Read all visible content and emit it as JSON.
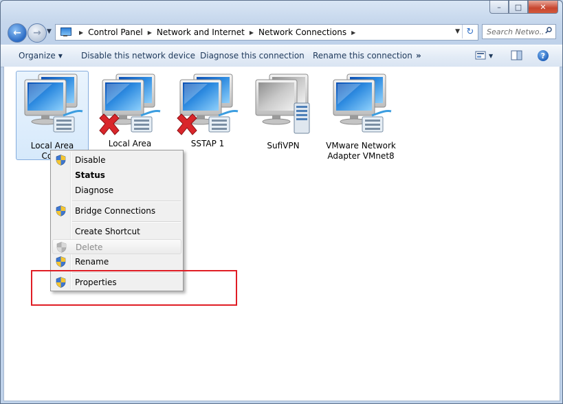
{
  "window": {
    "caption_buttons": {
      "minimize": "–",
      "maximize": "□",
      "close": "✕"
    }
  },
  "navigation": {
    "breadcrumbs": [
      "Control Panel",
      "Network and Internet",
      "Network Connections"
    ],
    "search_placeholder": "Search Netwo..."
  },
  "toolbar": {
    "organize": "Organize",
    "disable": "Disable this network device",
    "diagnose": "Diagnose this connection",
    "rename": "Rename this connection",
    "more": "»",
    "help": "?"
  },
  "connections": [
    {
      "line1": "Local Area",
      "line2": "Conn",
      "status": "selected"
    },
    {
      "line1": "Local Area",
      "line2": "",
      "status": "disconnected"
    },
    {
      "line1": "SSTAP 1",
      "line2": "",
      "status": "disconnected"
    },
    {
      "line1": "SufiVPN",
      "line2": "",
      "status": "vpn"
    },
    {
      "line1": "VMware Network",
      "line2": "Adapter VMnet8",
      "status": "connected"
    }
  ],
  "context_menu": {
    "items": [
      {
        "label": "Disable",
        "shield": true
      },
      {
        "label": "Status",
        "shield": false,
        "bold": true
      },
      {
        "label": "Diagnose",
        "shield": false
      },
      {
        "label": "Bridge Connections",
        "shield": true
      },
      {
        "label": "Create Shortcut",
        "shield": false
      },
      {
        "label": "Delete",
        "shield": true,
        "disabled": true
      },
      {
        "label": "Rename",
        "shield": true
      },
      {
        "label": "Properties",
        "shield": true
      }
    ]
  },
  "colors": {
    "highlight_border": "#e01c24",
    "selection_border": "#84acdd"
  }
}
